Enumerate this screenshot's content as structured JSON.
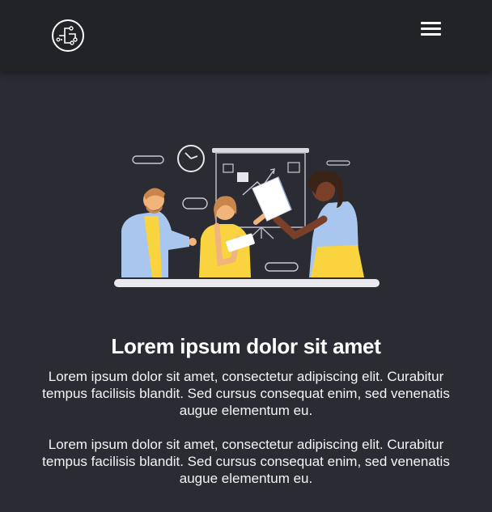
{
  "navbar": {
    "logo_icon": "circuit-circle-logo-icon",
    "menu_icon": "hamburger-menu-icon"
  },
  "hero": {
    "illustration": "team-meeting-presentation-illustration",
    "title": "Lorem ipsum dolor sit amet",
    "paragraphs": [
      "Lorem ipsum dolor sit amet, consectetur adipiscing elit. Curabitur tempus facilisis blandit. Sed cursus consequat enim, sed venenatis augue elementum eu.",
      "Lorem ipsum dolor sit amet, consectetur adipiscing elit. Curabitur tempus facilisis blandit. Sed cursus consequat enim, sed venenatis augue elementum eu."
    ]
  },
  "colors": {
    "background": "#2b2c33",
    "navbar": "#222327",
    "accent_yellow": "#f9d43f",
    "accent_blue": "#a8c6ee"
  }
}
